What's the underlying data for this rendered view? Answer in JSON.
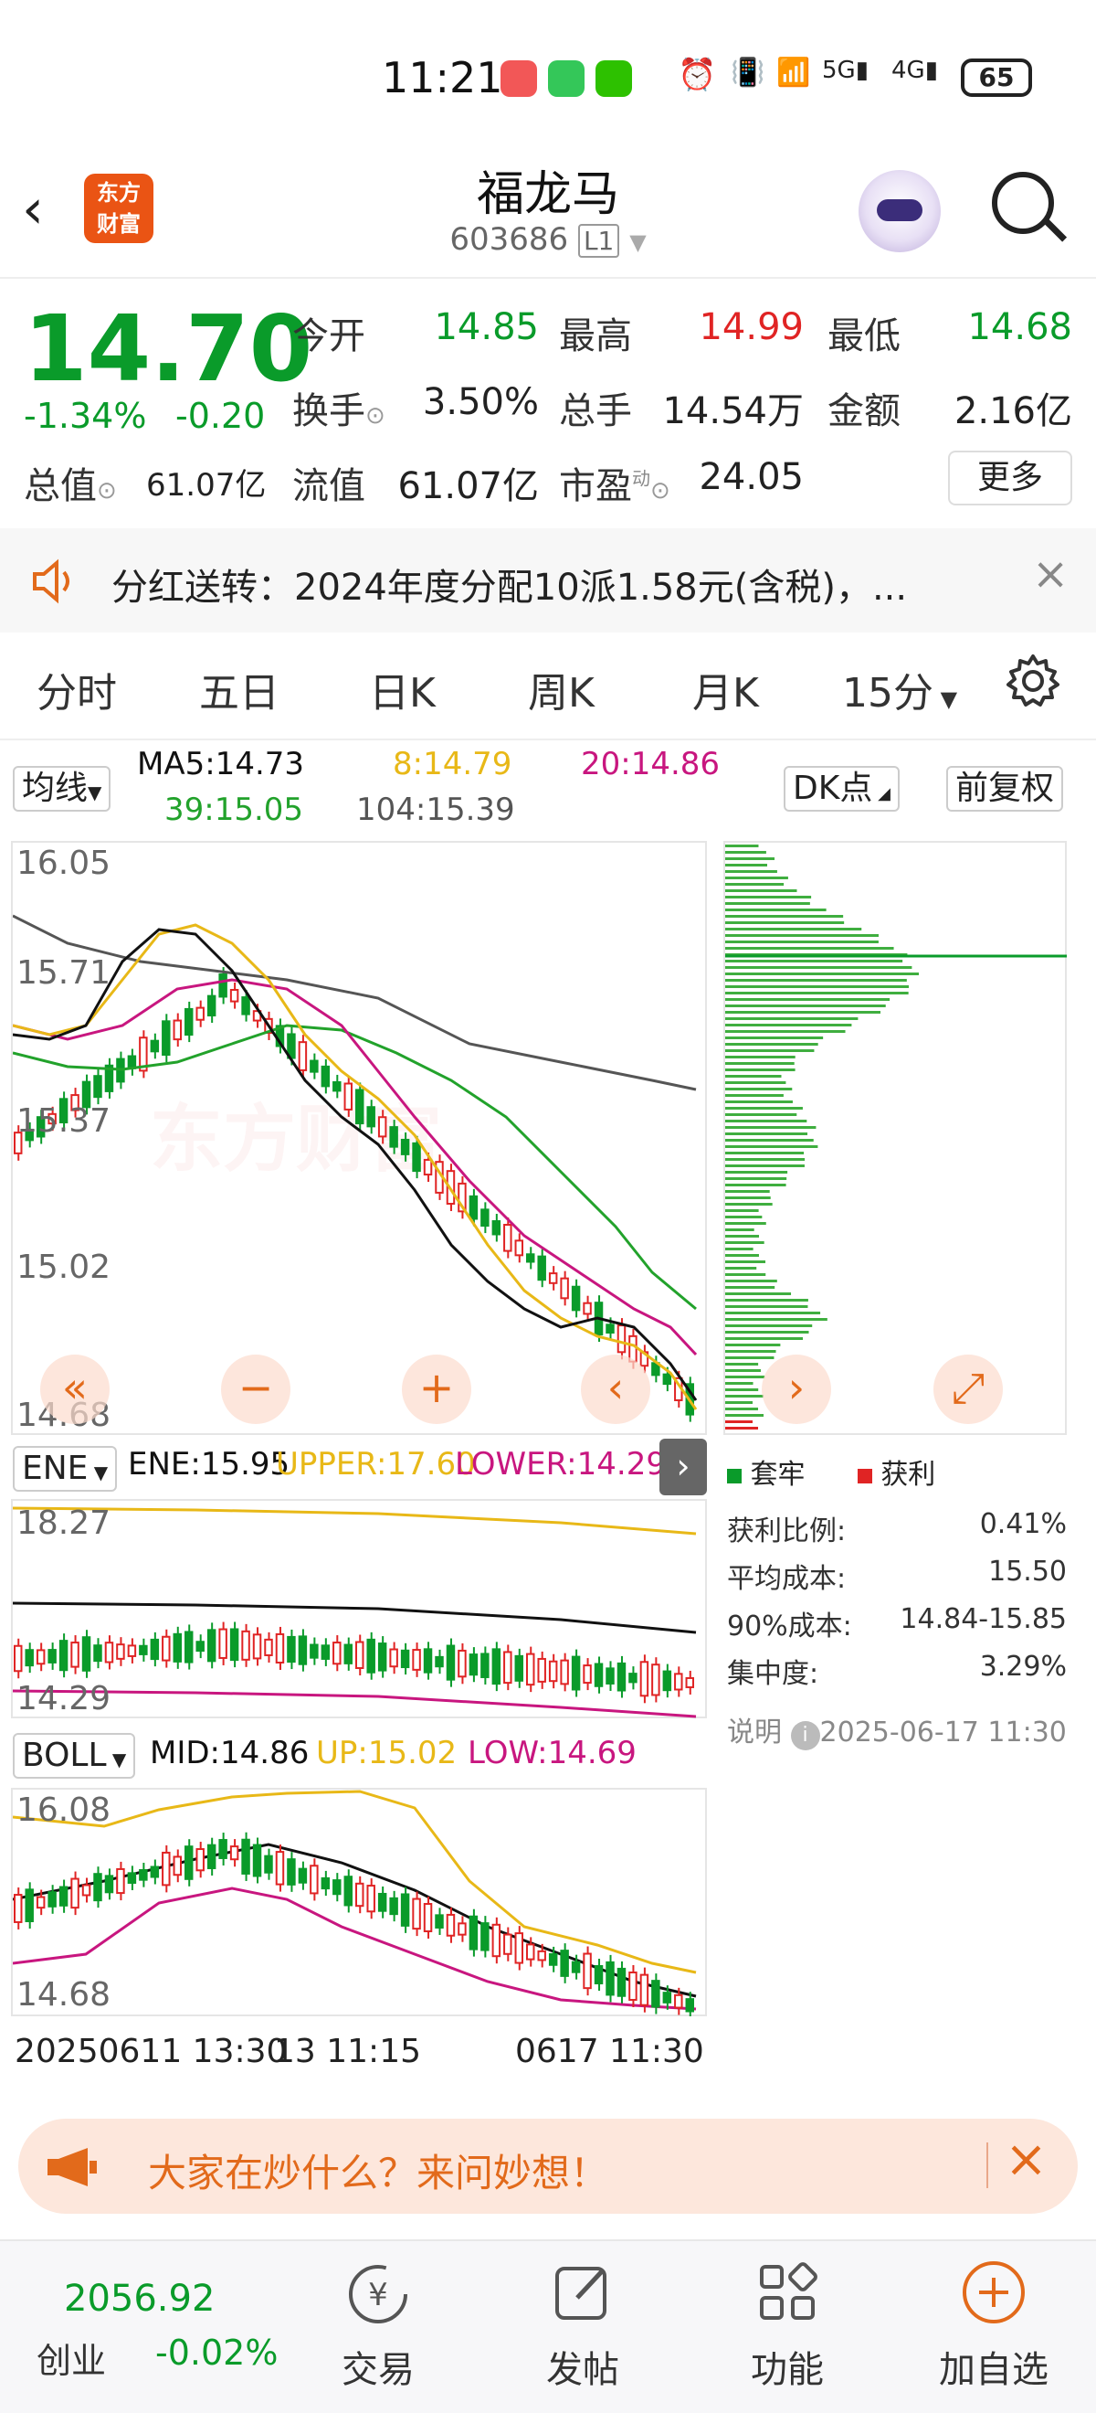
{
  "status_bar": {
    "time": "11:21",
    "battery": "65"
  },
  "header": {
    "logo_text_1": "东方",
    "logo_text_2": "财富",
    "stock_name": "福龙马",
    "stock_code": "603686",
    "level_badge": "L1"
  },
  "quote": {
    "price": "14.70",
    "change_pct": "-1.34%",
    "change": "-0.20",
    "open_label": "今开",
    "open": "14.85",
    "high_label": "最高",
    "high": "14.99",
    "low_label": "最低",
    "low": "14.68",
    "turnover_label": "换手",
    "turnover": "3.50%",
    "volume_label": "总手",
    "volume": "14.54万",
    "amount_label": "金额",
    "amount": "2.16亿",
    "total_value_label": "总值",
    "total_value": "61.07亿",
    "float_value_label": "流值",
    "float_value": "61.07亿",
    "pe_label": "市盈",
    "pe_sup": "动",
    "pe": "24.05",
    "more_button": "更多"
  },
  "notice": {
    "text": "分红送转：2024年度分配10派1.58元(含税)，..."
  },
  "tabs": [
    "分时",
    "五日",
    "日K",
    "周K",
    "月K",
    "15分"
  ],
  "ma_bar": {
    "selector": "均线",
    "ma5": "MA5:14.73",
    "ma8": "8:14.79",
    "ma20": "20:14.86",
    "ma39": "39:15.05",
    "ma104": "104:15.39",
    "dk_button": "DK点",
    "adjust_button": "前复权"
  },
  "main_chart": {
    "y_labels": [
      "16.05",
      "15.71",
      "15.37",
      "15.02",
      "14.68"
    ],
    "watermark": "东方财富"
  },
  "ene": {
    "selector": "ENE",
    "ene": "ENE:15.95",
    "upper": "UPPER:17.60",
    "lower": "LOWER:14.29",
    "y_top": "18.27",
    "y_bottom": "14.29"
  },
  "boll": {
    "selector": "BOLL",
    "mid": "MID:14.86",
    "up": "UP:15.02",
    "low": "LOW:14.69",
    "y_top": "16.08",
    "y_bottom": "14.68"
  },
  "x_axis": {
    "start": "20250611 13:30",
    "mid": "13 11:15",
    "end": "0617 11:30"
  },
  "chip_panel": {
    "legend_trapped": "套牢",
    "legend_profit": "获利",
    "rows": [
      {
        "label": "获利比例:",
        "value": "0.41%"
      },
      {
        "label": "平均成本:",
        "value": "15.50"
      },
      {
        "label": "90%成本:",
        "value": "14.84-15.85"
      },
      {
        "label": "集中度:",
        "value": "3.29%"
      }
    ],
    "note_label": "说明",
    "note_time": "2025-06-17 11:30"
  },
  "promo": {
    "text": "大家在炒什么？来问妙想！"
  },
  "bottom_nav": {
    "index_value": "2056.92",
    "index_name": "创业",
    "index_change": "-0.02%",
    "items": [
      "交易",
      "发帖",
      "功能",
      "加自选"
    ]
  },
  "colors": {
    "up": "#e02424",
    "down": "#0a9b2a",
    "accent": "#e26a1b",
    "ma5": "#111111",
    "ma8": "#e8b817",
    "ma20": "#c8167f",
    "ma39": "#22a22b",
    "ma104": "#555555"
  }
}
